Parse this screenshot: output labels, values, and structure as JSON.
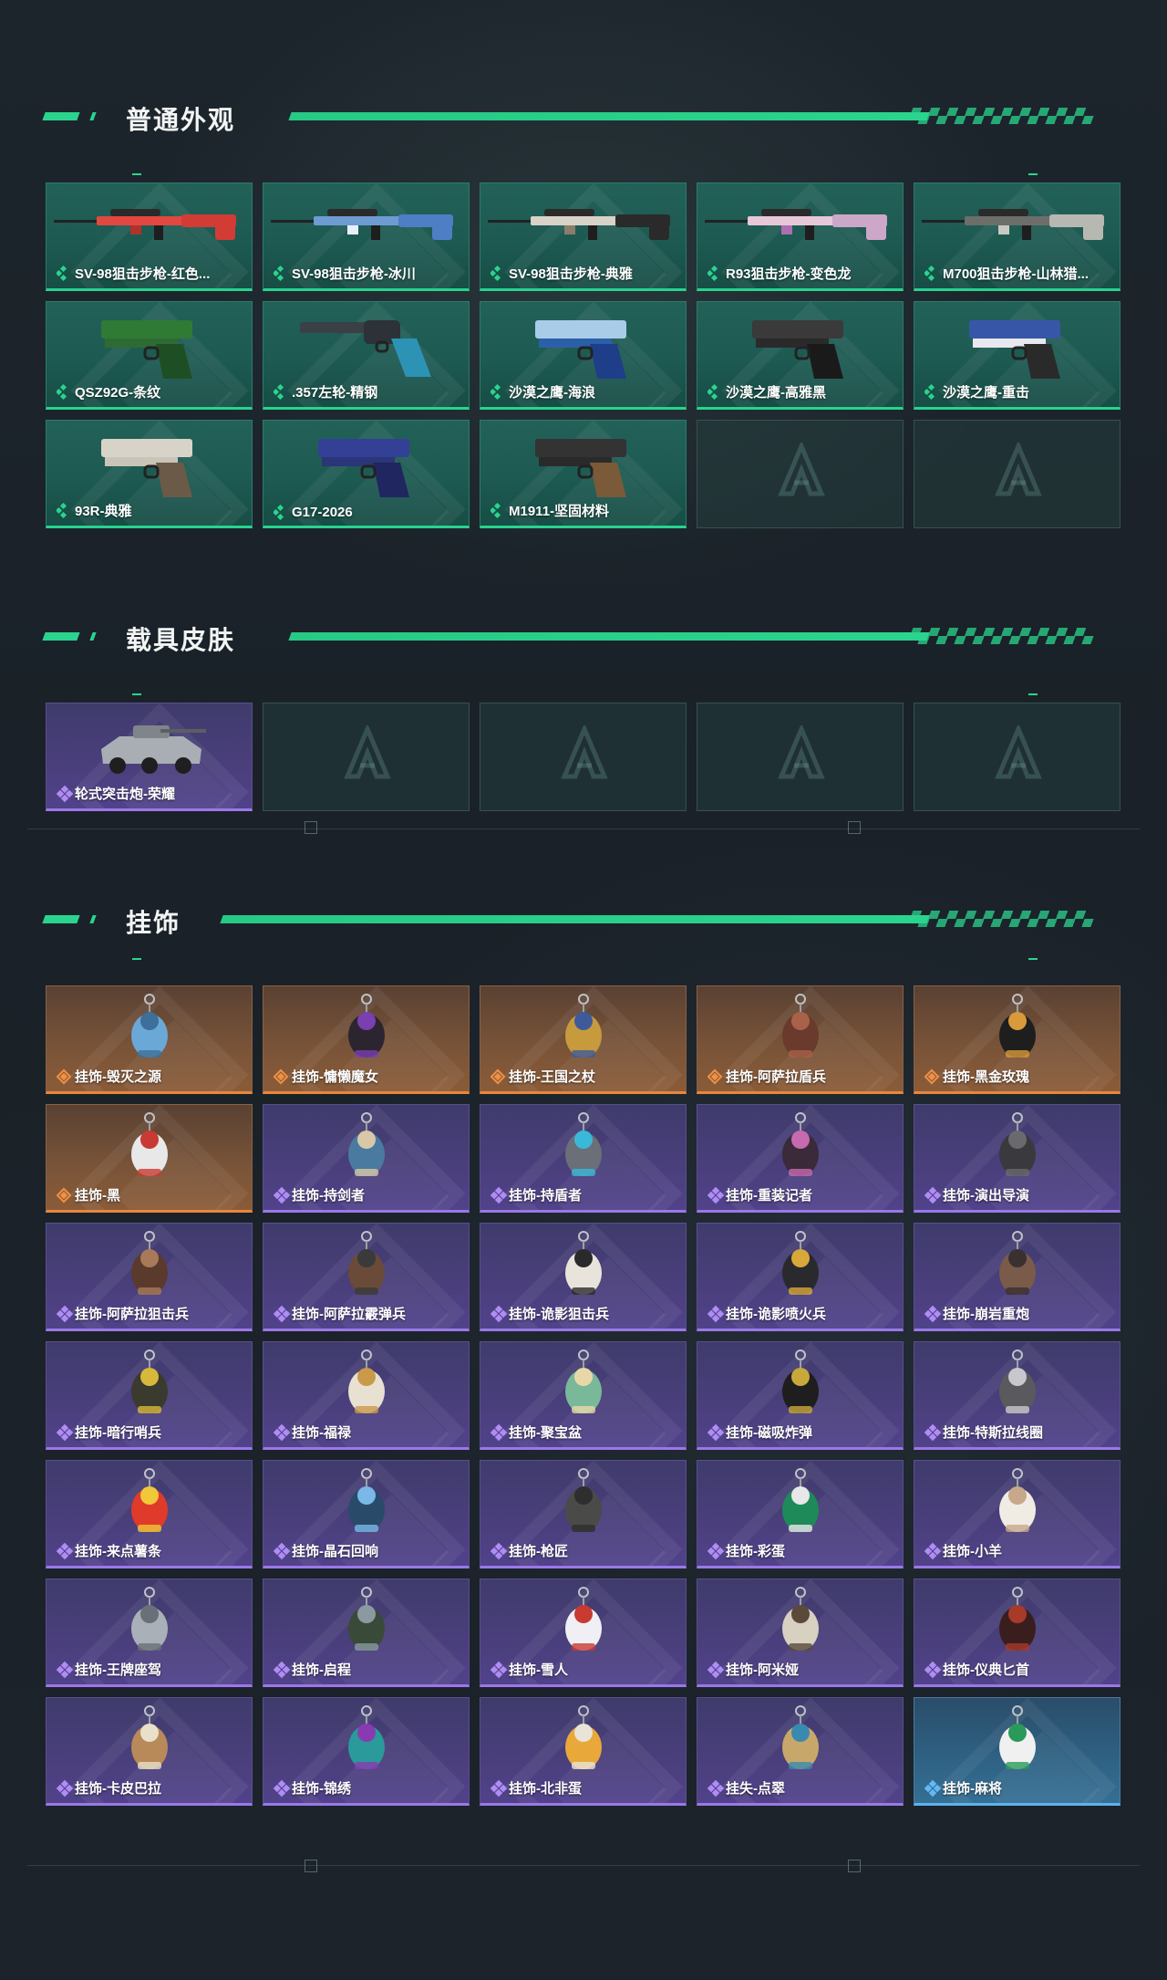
{
  "sections": {
    "weapons": {
      "title": "普通外观",
      "items": [
        {
          "label": "SV-98狙击步枪-红色...",
          "rarity": "green",
          "art": "rifle-red"
        },
        {
          "label": "SV-98狙击步枪-冰川",
          "rarity": "green",
          "art": "rifle-ice"
        },
        {
          "label": "SV-98狙击步枪-典雅",
          "rarity": "green",
          "art": "rifle-white"
        },
        {
          "label": "R93狙击步枪-变色龙",
          "rarity": "green",
          "art": "rifle-pink"
        },
        {
          "label": "M700狙击步枪-山林猎...",
          "rarity": "green",
          "art": "rifle-camo"
        },
        {
          "label": "QSZ92G-条纹",
          "rarity": "green",
          "art": "pistol-green"
        },
        {
          "label": ".357左轮-精钢",
          "rarity": "green",
          "art": "revolver"
        },
        {
          "label": "沙漠之鹰-海浪",
          "rarity": "green",
          "art": "deagle-blue"
        },
        {
          "label": "沙漠之鹰-高雅黑",
          "rarity": "green",
          "art": "deagle-black"
        },
        {
          "label": "沙漠之鹰-重击",
          "rarity": "green",
          "art": "deagle-white"
        },
        {
          "label": "93R-典雅",
          "rarity": "green",
          "art": "pistol-silver"
        },
        {
          "label": "G17-2026",
          "rarity": "green",
          "art": "glock-blue"
        },
        {
          "label": "M1911-坚固材料",
          "rarity": "green",
          "art": "m1911"
        }
      ],
      "empty_slots": 2
    },
    "vehicles": {
      "title": "载具皮肤",
      "items": [
        {
          "label": "轮式突击炮-荣耀",
          "rarity": "purple",
          "art": "vehicle"
        }
      ],
      "empty_slots": 4
    },
    "charms": {
      "title": "挂饰",
      "items": [
        {
          "label": "挂饰-毁灭之源",
          "rarity": "orange",
          "art": "dragon"
        },
        {
          "label": "挂饰-慵懒魔女",
          "rarity": "orange",
          "art": "witch"
        },
        {
          "label": "挂饰-王国之杖",
          "rarity": "orange",
          "art": "scepter"
        },
        {
          "label": "挂饰-阿萨拉盾兵",
          "rarity": "orange",
          "art": "shield-soldier"
        },
        {
          "label": "挂饰-黑金玫瑰",
          "rarity": "orange",
          "art": "rose"
        },
        {
          "label": "挂饰-黑",
          "rarity": "orange",
          "art": "tag"
        },
        {
          "label": "挂饰-持剑者",
          "rarity": "purple",
          "art": "figure-blue"
        },
        {
          "label": "挂饰-持盾者",
          "rarity": "purple",
          "art": "figure-spear"
        },
        {
          "label": "挂饰-重装记者",
          "rarity": "purple",
          "art": "figure-pink"
        },
        {
          "label": "挂饰-演出导演",
          "rarity": "purple",
          "art": "figure-dark"
        },
        {
          "label": "挂饰-阿萨拉狙击兵",
          "rarity": "purple",
          "art": "figure-sniper"
        },
        {
          "label": "挂饰-阿萨拉霰弹兵",
          "rarity": "purple",
          "art": "figure-shotgun"
        },
        {
          "label": "挂饰-诡影狙击兵",
          "rarity": "purple",
          "art": "figure-ghost"
        },
        {
          "label": "挂饰-诡影喷火兵",
          "rarity": "purple",
          "art": "figure-flame"
        },
        {
          "label": "挂饰-崩岩重炮",
          "rarity": "purple",
          "art": "figure-heavy"
        },
        {
          "label": "挂饰-暗行哨兵",
          "rarity": "purple",
          "art": "figure-sentry"
        },
        {
          "label": "挂饰-福禄",
          "rarity": "purple",
          "art": "gourd"
        },
        {
          "label": "挂饰-聚宝盆",
          "rarity": "purple",
          "art": "treasure"
        },
        {
          "label": "挂饰-磁吸炸弹",
          "rarity": "purple",
          "art": "bomb"
        },
        {
          "label": "挂饰-特斯拉线圈",
          "rarity": "purple",
          "art": "tesla"
        },
        {
          "label": "挂饰-来点薯条",
          "rarity": "purple",
          "art": "fries"
        },
        {
          "label": "挂饰-晶石回响",
          "rarity": "purple",
          "art": "crystal"
        },
        {
          "label": "挂饰-枪匠",
          "rarity": "purple",
          "art": "bag"
        },
        {
          "label": "挂饰-彩蛋",
          "rarity": "purple",
          "art": "egg"
        },
        {
          "label": "挂饰-小羊",
          "rarity": "purple",
          "art": "lamb"
        },
        {
          "label": "挂饰-王牌座驾",
          "rarity": "purple",
          "art": "plane"
        },
        {
          "label": "挂饰-启程",
          "rarity": "purple",
          "art": "compass"
        },
        {
          "label": "挂饰-雪人",
          "rarity": "purple",
          "art": "snowman"
        },
        {
          "label": "挂饰-阿米娅",
          "rarity": "purple",
          "art": "bunny"
        },
        {
          "label": "挂饰-仪典匕首",
          "rarity": "purple",
          "art": "dagger"
        },
        {
          "label": "挂饰-卡皮巴拉",
          "rarity": "purple",
          "art": "capybara"
        },
        {
          "label": "挂饰-锦绣",
          "rarity": "purple",
          "art": "butterfly"
        },
        {
          "label": "挂饰-北非蛋",
          "rarity": "purple",
          "art": "egg-plate"
        },
        {
          "label": "挂失-点翠",
          "rarity": "purple",
          "art": "jewel"
        },
        {
          "label": "挂饰-麻将",
          "rarity": "blue",
          "art": "mahjong"
        }
      ],
      "empty_slots": 0
    }
  },
  "colors": {
    "accent": "#2ad48e",
    "green_border": "#27d38f",
    "purple_border": "#9a78e8",
    "orange_border": "#e8873d",
    "blue_border": "#5bb3f0"
  }
}
